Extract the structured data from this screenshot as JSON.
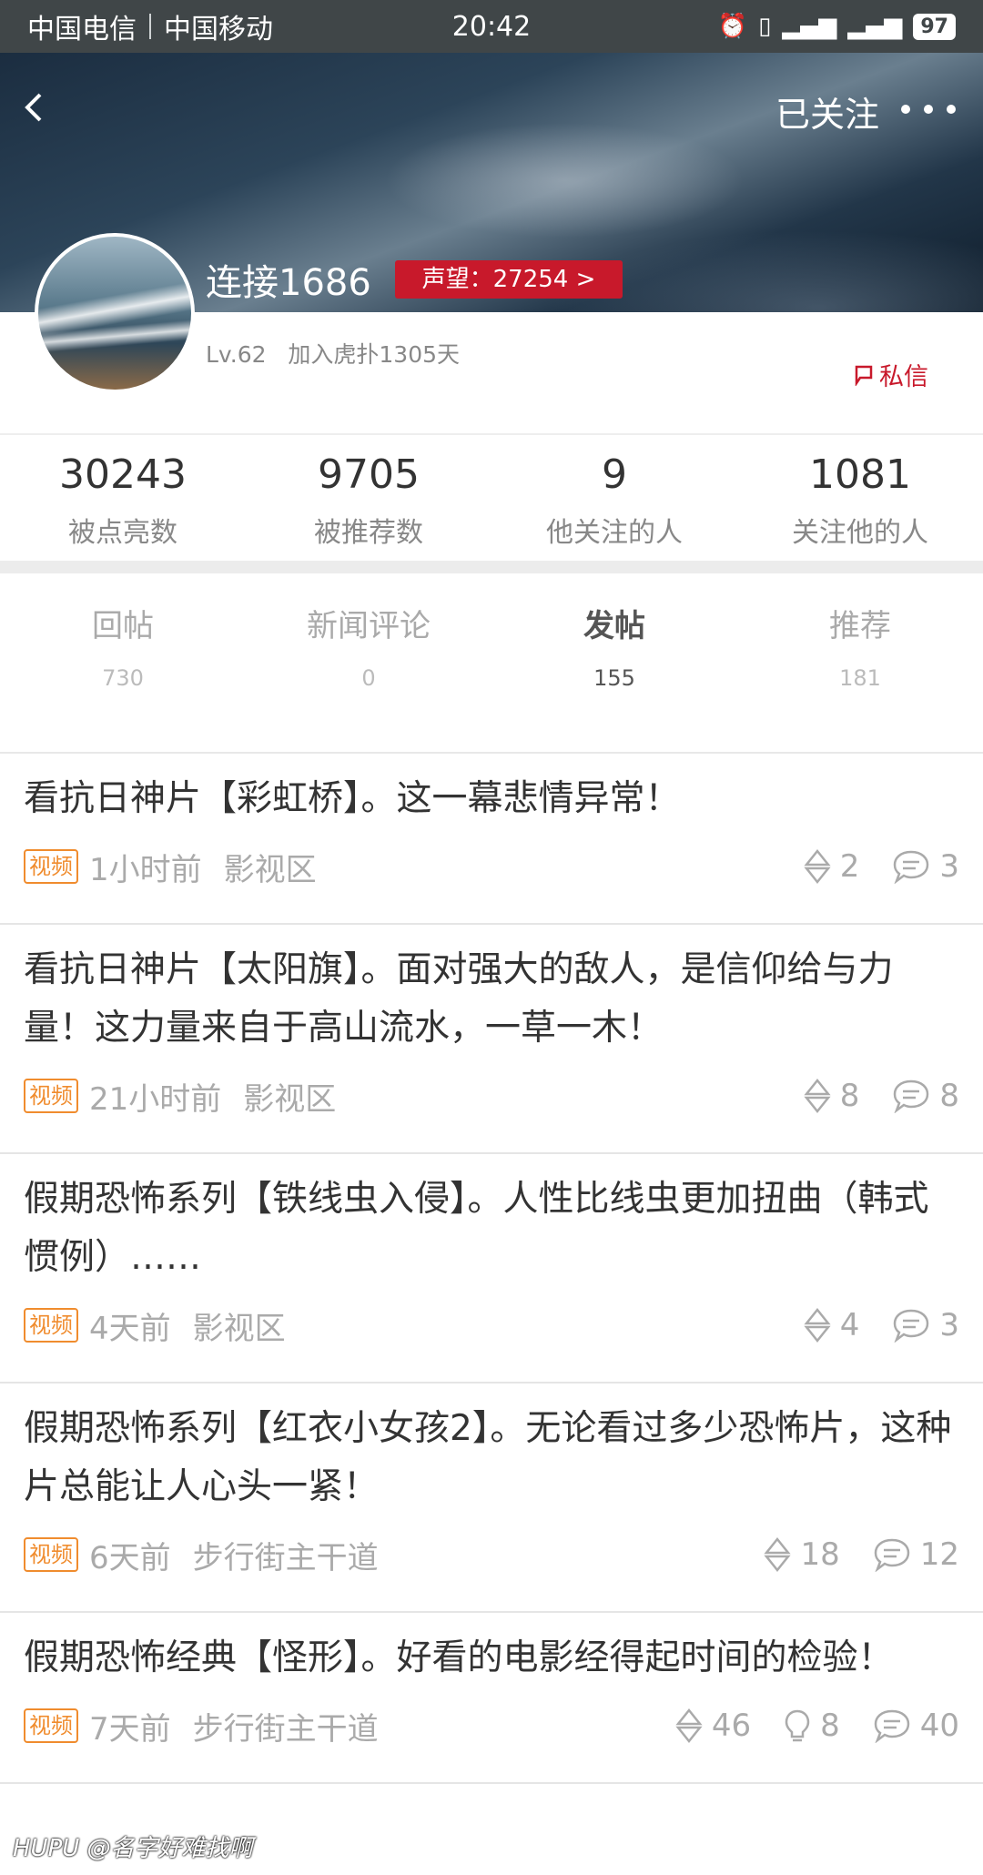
{
  "status_bar": {
    "carrier1": "中国电信",
    "carrier2": "中国移动",
    "time": "20:42",
    "battery": "97"
  },
  "header": {
    "follow_label": "已关注"
  },
  "profile": {
    "username": "连接1686",
    "reputation": "声望：27254 >",
    "level": "Lv.62",
    "joined": "加入虎扑1305天",
    "pm_label": "私信"
  },
  "stats": [
    {
      "value": "30243",
      "label": "被点亮数"
    },
    {
      "value": "9705",
      "label": "被推荐数"
    },
    {
      "value": "9",
      "label": "他关注的人"
    },
    {
      "value": "1081",
      "label": "关注他的人"
    }
  ],
  "tabs": [
    {
      "label": "回帖",
      "count": "730",
      "active": false
    },
    {
      "label": "新闻评论",
      "count": "0",
      "active": false
    },
    {
      "label": "发帖",
      "count": "155",
      "active": true
    },
    {
      "label": "推荐",
      "count": "181",
      "active": false
    }
  ],
  "posts": [
    {
      "title": "看抗日神片【彩虹桥】。这一幕悲情异常！",
      "badge": "视频",
      "time": "1小时前",
      "section": "影视区",
      "up": "2",
      "comments": "3"
    },
    {
      "title": "看抗日神片【太阳旗】。面对强大的敌人，是信仰给与力量！这力量来自于高山流水，一草一木！",
      "badge": "视频",
      "time": "21小时前",
      "section": "影视区",
      "up": "8",
      "comments": "8"
    },
    {
      "title": "假期恐怖系列【铁线虫入侵】。人性比线虫更加扭曲（韩式惯例）……",
      "badge": "视频",
      "time": "4天前",
      "section": "影视区",
      "up": "4",
      "comments": "3"
    },
    {
      "title": "假期恐怖系列【红衣小女孩2】。无论看过多少恐怖片，这种片总能让人心头一紧！",
      "badge": "视频",
      "time": "6天前",
      "section": "步行街主干道",
      "up": "18",
      "comments": "12"
    },
    {
      "title": "假期恐怖经典【怪形】。好看的电影经得起时间的检验！",
      "badge": "视频",
      "time": "7天前",
      "section": "步行街主干道",
      "up": "46",
      "lights": "8",
      "comments": "40"
    }
  ],
  "watermark": "HUPU @名字好难找啊",
  "icons": [
    "back-arrow-icon",
    "more-dots-icon",
    "message-icon",
    "alarm-icon",
    "vibrate-icon",
    "signal-icon",
    "upvote-icon",
    "comment-icon",
    "light-icon"
  ]
}
